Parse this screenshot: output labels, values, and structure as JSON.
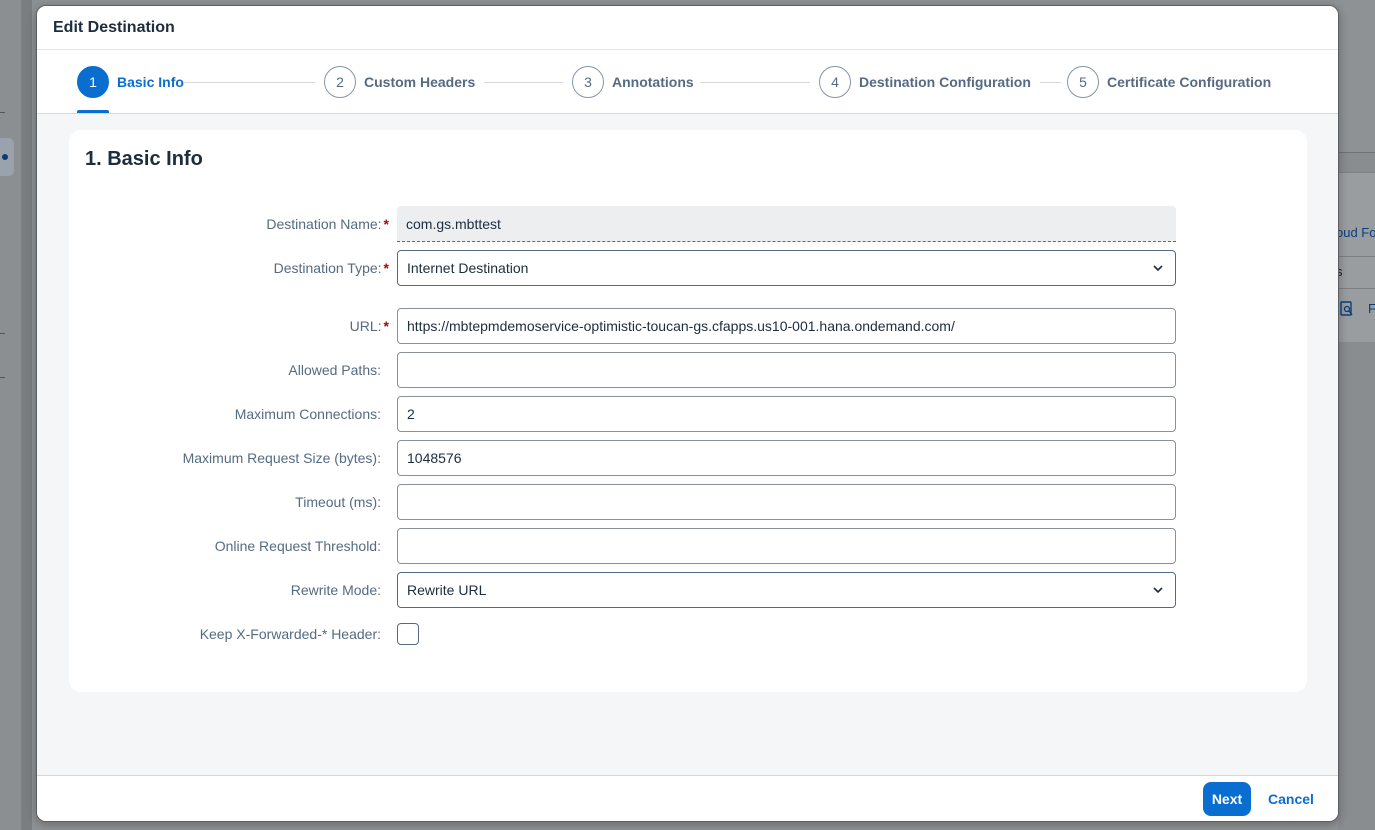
{
  "background": {
    "right_text_1": "oud Fo",
    "right_text_2": "s",
    "right_icon_label": "F"
  },
  "dialog": {
    "title": "Edit Destination"
  },
  "wizard": {
    "steps": [
      {
        "number": "1",
        "label": "Basic Info",
        "active": true
      },
      {
        "number": "2",
        "label": "Custom Headers",
        "active": false
      },
      {
        "number": "3",
        "label": "Annotations",
        "active": false
      },
      {
        "number": "4",
        "label": "Destination Configuration",
        "active": false
      },
      {
        "number": "5",
        "label": "Certificate Configuration",
        "active": false
      }
    ]
  },
  "section": {
    "title": "1. Basic Info"
  },
  "form": {
    "destination_name": {
      "label": "Destination Name:",
      "required": "*",
      "value": "com.gs.mbttest"
    },
    "destination_type": {
      "label": "Destination Type:",
      "required": "*",
      "value": "Internet Destination"
    },
    "url": {
      "label": "URL:",
      "required": "*",
      "value": "https://mbtepmdemoservice-optimistic-toucan-gs.cfapps.us10-001.hana.ondemand.com/"
    },
    "allowed_paths": {
      "label": "Allowed Paths:",
      "value": ""
    },
    "max_connections": {
      "label": "Maximum Connections:",
      "value": "2"
    },
    "max_request_size": {
      "label": "Maximum Request Size (bytes):",
      "value": "1048576"
    },
    "timeout": {
      "label": "Timeout (ms):",
      "value": ""
    },
    "online_request_threshold": {
      "label": "Online Request Threshold:",
      "value": ""
    },
    "rewrite_mode": {
      "label": "Rewrite Mode:",
      "value": "Rewrite URL"
    },
    "keep_x_forwarded": {
      "label": "Keep X-Forwarded-* Header:",
      "checked": false
    }
  },
  "footer": {
    "next_label": "Next",
    "cancel_label": "Cancel"
  },
  "colors": {
    "accent": "#0a6ed1",
    "required": "#aa0808",
    "label": "#556b82"
  }
}
